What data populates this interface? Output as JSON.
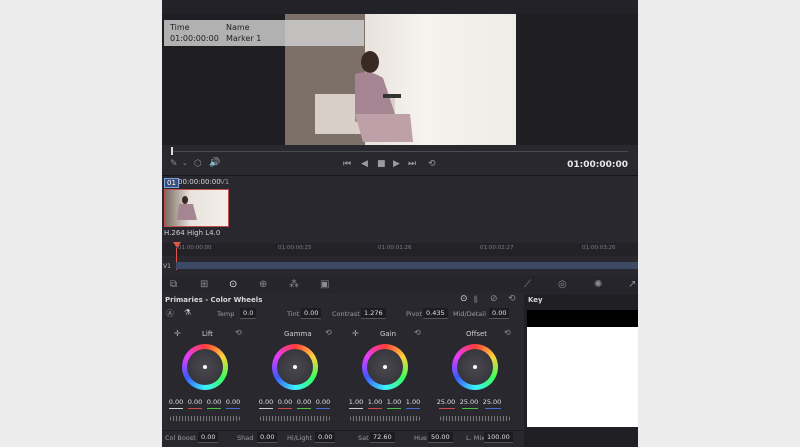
{
  "marker": {
    "time_header": "Time",
    "name_header": "Name",
    "time_value": "01:00:00:00",
    "name_value": "Marker 1"
  },
  "viewer": {
    "timecode": "01:00:00:00"
  },
  "clip": {
    "index": "01",
    "timecode": "00:00:00:00",
    "track": "V1",
    "codec": "H.264 High L4.0"
  },
  "ruler": {
    "ticks": [
      "01:00:00:00",
      "01:00:00:25",
      "01:00:01:26",
      "01:00:02:27",
      "01:00:03:26"
    ]
  },
  "track_label": "V1",
  "primaries": {
    "title": "Primaries - Color Wheels",
    "temp_label": "Temp",
    "temp": "0.0",
    "tint_label": "Tint",
    "tint": "0.00",
    "contrast_label": "Contrast",
    "contrast": "1.276",
    "pivot_label": "Pivot",
    "pivot": "0.435",
    "middetail_label": "Mid/Detail",
    "middetail": "0.00"
  },
  "wheels": [
    {
      "name": "Lift",
      "values": [
        "0.00",
        "0.00",
        "0.00",
        "0.00"
      ]
    },
    {
      "name": "Gamma",
      "values": [
        "0.00",
        "0.00",
        "0.00",
        "0.00"
      ]
    },
    {
      "name": "Gain",
      "values": [
        "1.00",
        "1.00",
        "1.00",
        "1.00"
      ]
    },
    {
      "name": "Offset",
      "values": [
        "25.00",
        "25.00",
        "25.00"
      ]
    }
  ],
  "bottom": {
    "colboost_label": "Col Boost",
    "colboost": "0.00",
    "shad_label": "Shad",
    "shad": "0.00",
    "hilight_label": "Hi/Light",
    "hilight": "0.00",
    "sat_label": "Sat",
    "sat": "72.60",
    "hue_label": "Hue",
    "hue": "50.00",
    "lmix_label": "L. Mix",
    "lmix": "100.00"
  },
  "key": {
    "title": "Key"
  }
}
